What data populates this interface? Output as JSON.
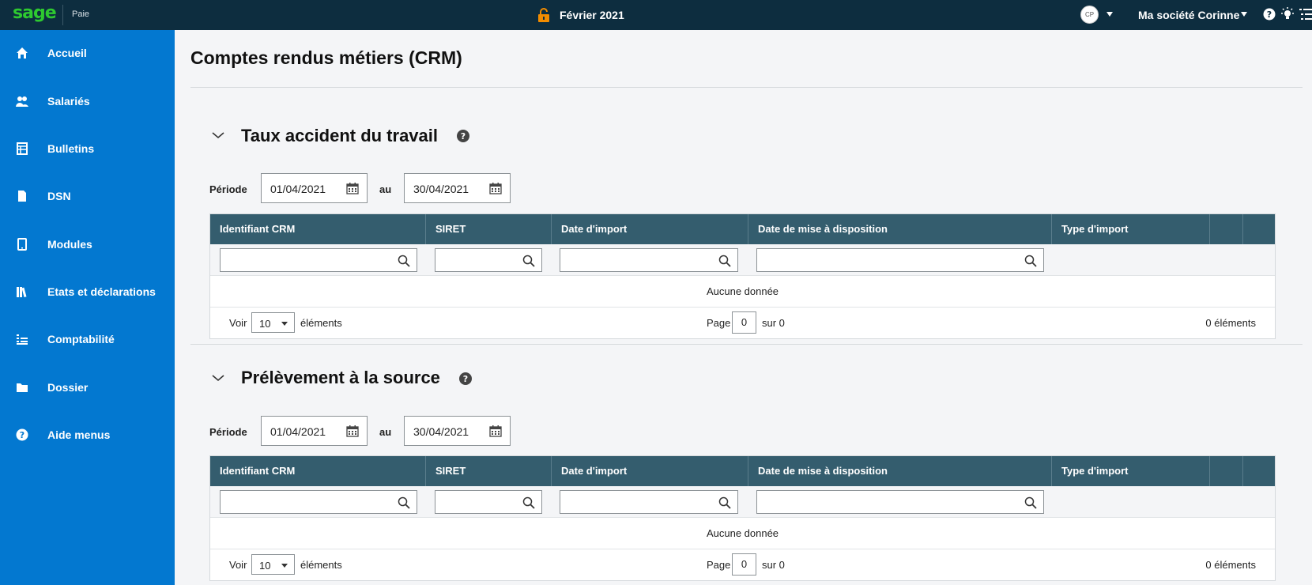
{
  "topbar": {
    "logo": "sage",
    "app_name": "Paie",
    "period": "Février 2021",
    "avatar_initials": "CP",
    "company": "Ma société Corinne",
    "icons": [
      "lock-open-icon",
      "help-icon",
      "bulb-icon",
      "list-icon"
    ],
    "accent_color": "#f28c00"
  },
  "sidebar": {
    "bg_color": "#0378d0",
    "items": [
      {
        "label": "Accueil",
        "icon": "home-icon"
      },
      {
        "label": "Salariés",
        "icon": "users-icon"
      },
      {
        "label": "Bulletins",
        "icon": "table-icon"
      },
      {
        "label": "DSN",
        "icon": "document-icon"
      },
      {
        "label": "Modules",
        "icon": "tablet-icon"
      },
      {
        "label": "Etats et déclarations",
        "icon": "books-icon"
      },
      {
        "label": "Comptabilité",
        "icon": "ledger-icon"
      },
      {
        "label": "Dossier",
        "icon": "folder-icon"
      },
      {
        "label": "Aide menus",
        "icon": "help-icon"
      }
    ]
  },
  "main": {
    "title": "Comptes rendus métiers (CRM)",
    "sections": [
      {
        "title": "Taux accident du travail",
        "periode_label": "Période",
        "date_from": "01/04/2021",
        "au_label": "au",
        "date_to": "30/04/2021",
        "columns": [
          "Identifiant CRM",
          "SIRET",
          "Date d'import",
          "Date de mise à disposition",
          "Type d'import",
          "",
          ""
        ],
        "empty_text": "Aucune donnée",
        "voir_label": "Voir",
        "page_size": "10",
        "elements_label": "éléments",
        "page_label": "Page",
        "page_value": "0",
        "sur_label": "sur 0",
        "count_label": "0 éléments"
      },
      {
        "title": "Prélèvement à la source",
        "periode_label": "Période",
        "date_from": "01/04/2021",
        "au_label": "au",
        "date_to": "30/04/2021",
        "columns": [
          "Identifiant CRM",
          "SIRET",
          "Date d'import",
          "Date de mise à disposition",
          "Type d'import",
          "",
          ""
        ],
        "empty_text": "Aucune donnée",
        "voir_label": "Voir",
        "page_size": "10",
        "elements_label": "éléments",
        "page_label": "Page",
        "page_value": "0",
        "sur_label": "sur 0",
        "count_label": "0 éléments"
      }
    ]
  }
}
